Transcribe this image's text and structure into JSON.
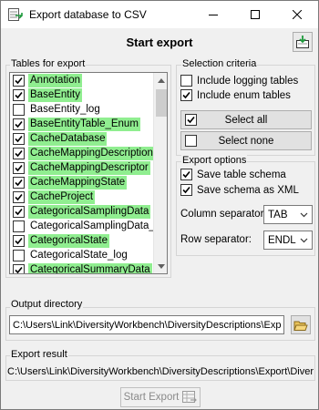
{
  "window": {
    "title": "Export database to CSV"
  },
  "main": {
    "heading": "Start export"
  },
  "tables": {
    "label": "Tables for export",
    "items": [
      {
        "name": "Annotation",
        "checked": true,
        "highlight": true
      },
      {
        "name": "BaseEntity",
        "checked": true,
        "highlight": true
      },
      {
        "name": "BaseEntity_log",
        "checked": false,
        "highlight": false
      },
      {
        "name": "BaseEntityTable_Enum",
        "checked": true,
        "highlight": true
      },
      {
        "name": "CacheDatabase",
        "checked": true,
        "highlight": true
      },
      {
        "name": "CacheMappingDescription",
        "checked": true,
        "highlight": true
      },
      {
        "name": "CacheMappingDescriptor",
        "checked": true,
        "highlight": true
      },
      {
        "name": "CacheMappingState",
        "checked": true,
        "highlight": true
      },
      {
        "name": "CacheProject",
        "checked": true,
        "highlight": true
      },
      {
        "name": "CategoricalSamplingData",
        "checked": true,
        "highlight": true
      },
      {
        "name": "CategoricalSamplingData_log",
        "checked": false,
        "highlight": false
      },
      {
        "name": "CategoricalState",
        "checked": true,
        "highlight": true
      },
      {
        "name": "CategoricalState_log",
        "checked": false,
        "highlight": false
      },
      {
        "name": "CategoricalSummaryData",
        "checked": true,
        "highlight": true
      }
    ]
  },
  "selection": {
    "label": "Selection criteria",
    "include_logging": "Include logging tables",
    "include_logging_checked": false,
    "include_enum": "Include enum tables",
    "include_enum_checked": true,
    "select_all": "Select all",
    "select_none": "Select none"
  },
  "export_options": {
    "label": "Export options",
    "save_schema": "Save table schema",
    "save_schema_checked": true,
    "save_xml": "Save schema as XML",
    "save_xml_checked": true,
    "column_separator_label": "Column separator:",
    "column_separator_value": "TAB",
    "row_separator_label": "Row separator:",
    "row_separator_value": "ENDL"
  },
  "output": {
    "label": "Output directory",
    "path": "C:\\Users\\Link\\DiversityWorkbench\\DiversityDescriptions\\Exp"
  },
  "result": {
    "label": "Export result",
    "text": "C:\\Users\\Link\\DiversityWorkbench\\DiversityDescriptions\\Export\\Diver"
  },
  "actions": {
    "start_export": "Start Export"
  },
  "colors": {
    "highlight": "#90ee90",
    "icon_green": "#1e9a3c"
  }
}
